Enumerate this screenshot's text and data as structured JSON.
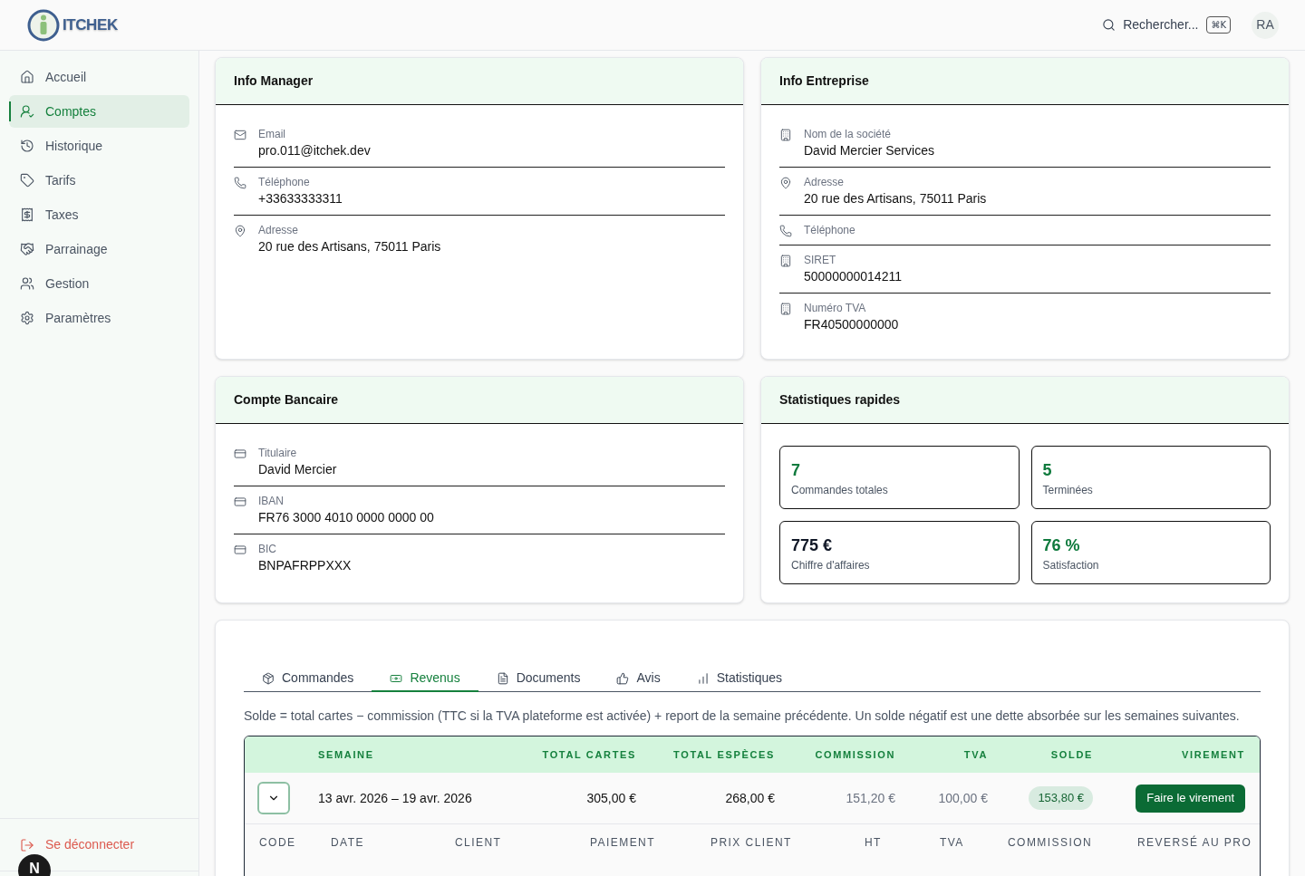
{
  "header": {
    "logo": "ITCHEK",
    "search": {
      "label": "Rechercher...",
      "shortcut": "⌘K"
    },
    "avatar": "RA"
  },
  "sidebar": {
    "items": [
      {
        "label": "Accueil",
        "selected": false
      },
      {
        "label": "Comptes",
        "selected": true
      },
      {
        "label": "Historique",
        "selected": false
      },
      {
        "label": "Tarifs",
        "selected": false
      },
      {
        "label": "Taxes",
        "selected": false
      },
      {
        "label": "Parrainage",
        "selected": false
      },
      {
        "label": "Gestion",
        "selected": false
      },
      {
        "label": "Paramètres",
        "selected": false
      }
    ],
    "logout": "Se déconnecter"
  },
  "info_manager": {
    "title": "Info Manager",
    "rows": [
      {
        "label": "Email",
        "value": "pro.011@itchek.dev"
      },
      {
        "label": "Téléphone",
        "value": "+33633333311"
      },
      {
        "label": "Adresse",
        "value": "20 rue des Artisans, 75011 Paris"
      }
    ]
  },
  "info_entreprise": {
    "title": "Info Entreprise",
    "rows": [
      {
        "label": "Nom de la société",
        "value": "David Mercier Services"
      },
      {
        "label": "Adresse",
        "value": "20 rue des Artisans, 75011 Paris"
      },
      {
        "label": "Téléphone"
      },
      {
        "label": "SIRET",
        "value": "50000000014211"
      },
      {
        "label": "Numéro TVA",
        "value": "FR40500000000"
      }
    ]
  },
  "compte_bancaire": {
    "title": "Compte Bancaire",
    "rows": [
      {
        "label": "Titulaire",
        "value": "David Mercier"
      },
      {
        "label": "IBAN",
        "value": "FR76 3000 4010 0000 0000 00"
      },
      {
        "label": "BIC",
        "value": "BNPAFRPPXXX"
      }
    ]
  },
  "statistiques": {
    "title": "Statistiques rapides",
    "items": [
      {
        "value": "7",
        "label": "Commandes totales",
        "color": "#0f7a3d"
      },
      {
        "value": "5",
        "label": "Terminées",
        "color": "#0f7a3d"
      },
      {
        "value": "775 €",
        "label": "Chiffre d'affaires",
        "color": "#111827"
      },
      {
        "value": "76 %",
        "label": "Satisfaction",
        "color": "#0f7a3d"
      }
    ]
  },
  "details": {
    "tabs": [
      {
        "label": "Commandes",
        "selected": false
      },
      {
        "label": "Revenus",
        "selected": true
      },
      {
        "label": "Documents",
        "selected": false
      },
      {
        "label": "Avis",
        "selected": false
      },
      {
        "label": "Statistiques",
        "selected": false
      }
    ],
    "note": "Solde = total cartes − commission (TTC si la TVA plateforme est activée) + report de la semaine précédente. Un solde négatif est une dette absorbée sur les semaines suivantes.",
    "table": {
      "columns": [
        "SEMAINE",
        "TOTAL CARTES",
        "TOTAL ESPÈCES",
        "COMMISSION",
        "TVA",
        "SOLDE",
        "VIREMENT"
      ],
      "rows": [
        {
          "expanded": true,
          "week": "13 avr. 2026 – 19 avr. 2026",
          "total_cartes": "305,00 €",
          "total_especes": "268,00 €",
          "commission": "151,20 €",
          "tva": "100,00 €",
          "solde": "153,80 €",
          "action": "Faire le virement",
          "detail_columns": [
            "CODE",
            "DATE",
            "CLIENT",
            "PAIEMENT",
            "PRIX CLIENT",
            "HT",
            "TVA",
            "COMMISSION",
            "REVERSÉ AU PRO"
          ]
        }
      ]
    }
  },
  "dev_indicator": "N"
}
